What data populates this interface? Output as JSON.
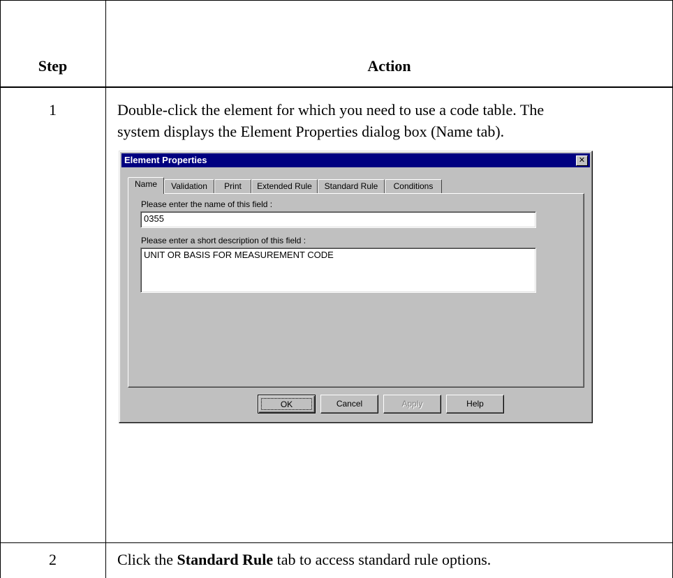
{
  "table": {
    "header": {
      "step": "Step",
      "action": "Action"
    },
    "rows": [
      {
        "step": "1",
        "line1": "Double-click the element for which you need to use a code table. The",
        "line2": "system displays the Element Properties dialog box (Name tab)."
      },
      {
        "step": "2",
        "text_before": "Click the ",
        "text_bold": "Standard Rule",
        "text_after": " tab to access standard rule options."
      }
    ]
  },
  "dialog": {
    "title": "Element Properties",
    "close_glyph": "✕",
    "tabs": [
      "Name",
      "Validation",
      "Print",
      "Extended Rule",
      "Standard Rule",
      "Conditions"
    ],
    "active_tab": "Name",
    "name_label": "Please enter the name of this field :",
    "name_value": "0355",
    "desc_label": "Please enter a short description of this field :",
    "desc_value": "UNIT OR BASIS FOR MEASUREMENT CODE",
    "buttons": {
      "ok": "OK",
      "cancel": "Cancel",
      "apply": "Apply",
      "help": "Help"
    }
  }
}
